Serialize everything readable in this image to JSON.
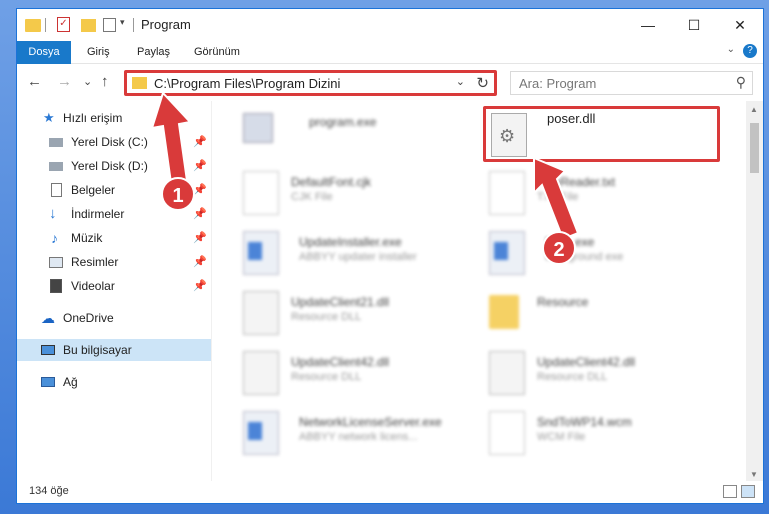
{
  "window": {
    "title": "Program",
    "min": "—",
    "max": "☐",
    "close": "✕"
  },
  "ribbon": {
    "tabs": [
      "Dosya",
      "Giriş",
      "Paylaş",
      "Görünüm"
    ],
    "help": "?",
    "expand": "⌄"
  },
  "nav": {
    "back": "←",
    "forward": "→",
    "recent": "⌄",
    "up": "↑",
    "address": "C:\\Program Files\\Program Dizini",
    "dropdown": "⌄",
    "refresh": "↻",
    "search_placeholder": "Ara: Program",
    "search_icon": "⚲"
  },
  "sidebar": {
    "items": [
      {
        "label": "Hızlı erişim",
        "icon": "star-icon"
      },
      {
        "label": "Yerel Disk (C:)",
        "icon": "drive-icon",
        "pin": "📌"
      },
      {
        "label": "Yerel Disk (D:)",
        "icon": "drive-icon",
        "pin": "📌"
      },
      {
        "label": "Belgeler",
        "icon": "documents-icon",
        "pin": "📌"
      },
      {
        "label": "İndirmeler",
        "icon": "download-icon",
        "pin": "📌"
      },
      {
        "label": "Müzik",
        "icon": "music-icon",
        "pin": "📌"
      },
      {
        "label": "Resimler",
        "icon": "pictures-icon",
        "pin": "📌"
      },
      {
        "label": "Videolar",
        "icon": "videos-icon",
        "pin": "📌"
      },
      {
        "label": "OneDrive",
        "icon": "cloud-icon"
      },
      {
        "label": "Bu bilgisayar",
        "icon": "computer-icon"
      },
      {
        "label": "Ağ",
        "icon": "network-icon"
      }
    ]
  },
  "files": [
    {
      "name": "program.exe",
      "type": ""
    },
    {
      "name": "poser.dll",
      "type": ""
    },
    {
      "name": "DefaultFont.cjk",
      "type": "CJK File"
    },
    {
      "name": "FineReader.txt",
      "type": "TXT File"
    },
    {
      "name": "UpdateInstaller.exe",
      "type": "ABBYY updater installer"
    },
    {
      "name": "Exec.exe",
      "type": "background exe"
    },
    {
      "name": "UpdateClient21.dll",
      "type": "Resource DLL"
    },
    {
      "name": "Resource",
      "type": ""
    },
    {
      "name": "UpdateClient42.dll",
      "type": "Resource DLL"
    },
    {
      "name": "UpdateClient42.dll",
      "type": "Resource DLL"
    },
    {
      "name": "NetworkLicenseServer.exe",
      "type": "ABBYY network licens..."
    },
    {
      "name": "SndToWP14.wcm",
      "type": "WCM File"
    }
  ],
  "status": {
    "count": "134 öğe"
  },
  "annotations": {
    "badge1": "1",
    "badge2": "2"
  },
  "colors": {
    "highlight": "#d93a3a",
    "accent": "#1979ca"
  }
}
